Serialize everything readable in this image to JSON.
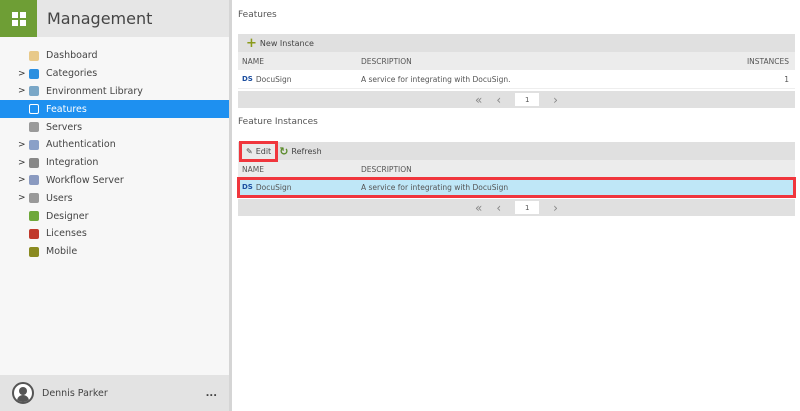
{
  "app": {
    "title": "Management"
  },
  "sidebar": {
    "items": [
      {
        "label": "Dashboard",
        "icon": "dashboard-icon",
        "expandable": false,
        "color": "#e8c98a"
      },
      {
        "label": "Categories",
        "icon": "folder-icon",
        "expandable": true,
        "color": "#2a8fe0"
      },
      {
        "label": "Environment Library",
        "icon": "library-icon",
        "expandable": true,
        "color": "#7aa7c7"
      },
      {
        "label": "Features",
        "icon": "features-icon",
        "expandable": false,
        "color": "#ffffff",
        "selected": true
      },
      {
        "label": "Servers",
        "icon": "server-icon",
        "expandable": false,
        "color": "#9a9a9a"
      },
      {
        "label": "Authentication",
        "icon": "key-icon",
        "expandable": true,
        "color": "#8aa0c8"
      },
      {
        "label": "Integration",
        "icon": "puzzle-icon",
        "expandable": true,
        "color": "#888888"
      },
      {
        "label": "Workflow Server",
        "icon": "workflow-server-icon",
        "expandable": true,
        "color": "#8a9ac0"
      },
      {
        "label": "Users",
        "icon": "user-icon",
        "expandable": true,
        "color": "#999999"
      },
      {
        "label": "Designer",
        "icon": "designer-icon",
        "expandable": false,
        "color": "#6ea83a"
      },
      {
        "label": "Licenses",
        "icon": "license-icon",
        "expandable": false,
        "color": "#c0392b"
      },
      {
        "label": "Mobile",
        "icon": "mobile-icon",
        "expandable": false,
        "color": "#8a8a20"
      }
    ]
  },
  "user": {
    "name": "Dennis Parker",
    "more": "..."
  },
  "features": {
    "title": "Features",
    "new_instance": "New Instance",
    "columns": [
      "NAME",
      "DESCRIPTION",
      "INSTANCES"
    ],
    "rows": [
      {
        "name": "DocuSign",
        "description": "A service for integrating with DocuSign.",
        "instances": "1"
      }
    ],
    "page": "1"
  },
  "instances": {
    "title": "Feature Instances",
    "edit": "Edit",
    "refresh": "Refresh",
    "columns": [
      "NAME",
      "DESCRIPTION"
    ],
    "rows": [
      {
        "name": "DocuSign",
        "description": "A service for integrating with DocuSign"
      }
    ],
    "page": "1"
  },
  "icons": {
    "docusign": "DS",
    "first": "«",
    "prev": "‹",
    "next": "›",
    "chevron": ">"
  }
}
